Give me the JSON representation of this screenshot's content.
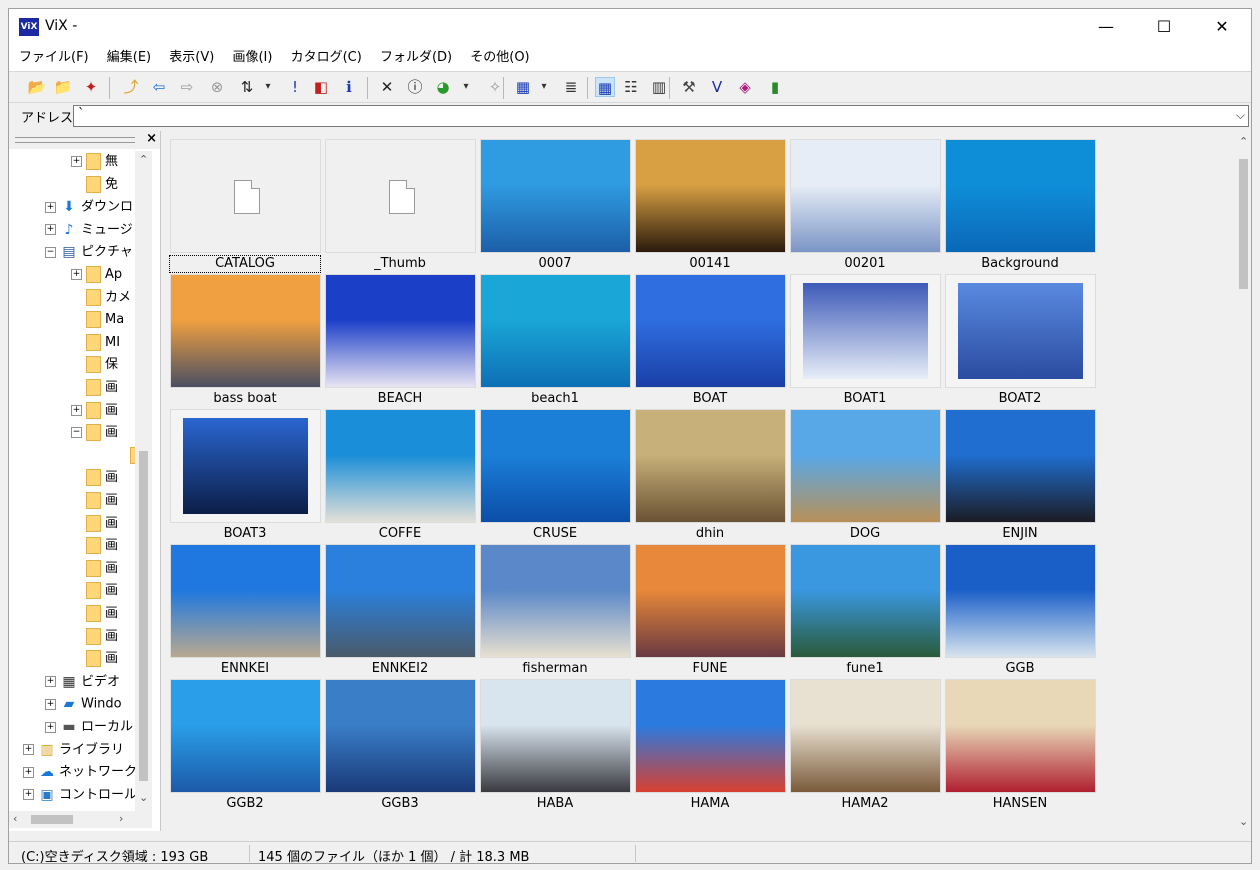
{
  "window": {
    "title": "ViX -",
    "app_icon": "ViX",
    "minimize": "—",
    "maximize": "☐",
    "close": "✕"
  },
  "menu": [
    "ファイル(F)",
    "編集(E)",
    "表示(V)",
    "画像(I)",
    "カタログ(C)",
    "フォルダ(D)",
    "その他(O)"
  ],
  "toolbar": {
    "icons": [
      "open-folder-icon",
      "new-folder-icon",
      "slideshow-icon",
      "up-folder-icon",
      "back-arrow-icon",
      "forward-arrow-icon",
      "stop-icon",
      "sort-icon",
      "sort-dropdown-icon",
      "exclamation-icon",
      "preview-icon",
      "info-icon",
      "delete-icon",
      "properties-icon",
      "color-icon",
      "color-dropdown-icon",
      "plugin-icon",
      "view-menu-icon",
      "view-dropdown-icon",
      "list-icon",
      "large-thumbnails-icon",
      "details-icon",
      "columns-icon",
      "tools-icon",
      "vix-icon",
      "book-icon",
      "exit-icon"
    ],
    "glyphs": [
      "📂",
      "📁",
      "✦",
      "⤴",
      "⇦",
      "⇨",
      "⊗",
      "⇅",
      "▾",
      "!",
      "◧",
      "ℹ",
      "✕",
      "ⓘ",
      "◕",
      "▾",
      "✧",
      "▦",
      "▾",
      "≣",
      "▦",
      "☷",
      "▥",
      "⚒",
      "V",
      "◈",
      "▮"
    ]
  },
  "address": {
    "label": "アドレス",
    "value": "`"
  },
  "tree": {
    "nodes": [
      {
        "label": "無",
        "level": 3,
        "type": "folder",
        "expander": "+"
      },
      {
        "label": "免",
        "level": 3,
        "type": "folder",
        "expander": ""
      },
      {
        "label": "ダウンロ",
        "level": 2,
        "type": "download",
        "expander": "+"
      },
      {
        "label": "ミュージ",
        "level": 2,
        "type": "music",
        "expander": "+"
      },
      {
        "label": "ピクチャ",
        "level": 2,
        "type": "pictures",
        "expander": "−"
      },
      {
        "label": "Ap",
        "level": 3,
        "type": "folder",
        "expander": "+"
      },
      {
        "label": "カメ",
        "level": 3,
        "type": "folder",
        "expander": ""
      },
      {
        "label": "Ma",
        "level": 3,
        "type": "folder",
        "expander": ""
      },
      {
        "label": "MI",
        "level": 3,
        "type": "folder",
        "expander": ""
      },
      {
        "label": "保",
        "level": 3,
        "type": "folder",
        "expander": ""
      },
      {
        "label": "画",
        "level": 3,
        "type": "folder",
        "expander": ""
      },
      {
        "label": "画",
        "level": 3,
        "type": "folder",
        "expander": "+"
      },
      {
        "label": "画",
        "level": 3,
        "type": "folder",
        "expander": "−"
      },
      {
        "label": "",
        "level": 4,
        "type": "folder",
        "expander": ""
      },
      {
        "label": "画",
        "level": 3,
        "type": "folder",
        "expander": ""
      },
      {
        "label": "画",
        "level": 3,
        "type": "folder",
        "expander": ""
      },
      {
        "label": "画",
        "level": 3,
        "type": "folder",
        "expander": ""
      },
      {
        "label": "画",
        "level": 3,
        "type": "folder",
        "expander": ""
      },
      {
        "label": "画",
        "level": 3,
        "type": "folder",
        "expander": ""
      },
      {
        "label": "画",
        "level": 3,
        "type": "folder",
        "expander": ""
      },
      {
        "label": "画",
        "level": 3,
        "type": "folder",
        "expander": ""
      },
      {
        "label": "画",
        "level": 3,
        "type": "folder",
        "expander": ""
      },
      {
        "label": "画",
        "level": 3,
        "type": "folder",
        "expander": ""
      },
      {
        "label": "ビデオ",
        "level": 2,
        "type": "video",
        "expander": "+"
      },
      {
        "label": "Windo",
        "level": 2,
        "type": "windows",
        "expander": "+"
      },
      {
        "label": "ローカル",
        "level": 2,
        "type": "drive",
        "expander": "+"
      },
      {
        "label": "ライブラリ",
        "level": 1,
        "type": "library",
        "expander": "+"
      },
      {
        "label": "ネットワーク",
        "level": 1,
        "type": "network",
        "expander": "+"
      },
      {
        "label": "コントロール",
        "level": 1,
        "type": "control",
        "expander": "+"
      }
    ]
  },
  "thumbnails": [
    {
      "name": "CATALOG",
      "kind": "folder",
      "c1": "#f0f0f0",
      "c2": "#f0f0f0"
    },
    {
      "name": "_Thumb",
      "kind": "folder",
      "c1": "#f0f0f0",
      "c2": "#f0f0f0"
    },
    {
      "name": "0007",
      "kind": "photo",
      "c1": "#2f9be0",
      "c2": "#1c5fa8"
    },
    {
      "name": "00141",
      "kind": "photo",
      "c1": "#d8a043",
      "c2": "#2a1a0c"
    },
    {
      "name": "00201",
      "kind": "photo",
      "c1": "#e6edf6",
      "c2": "#7b95c6"
    },
    {
      "name": "Background",
      "kind": "photo",
      "c1": "#0f8ed8",
      "c2": "#0a68b8"
    },
    {
      "name": "bass boat",
      "kind": "photo",
      "c1": "#f0a040",
      "c2": "#4a4f62"
    },
    {
      "name": "BEACH",
      "kind": "photo",
      "c1": "#1c3fc8",
      "c2": "#e8e4f2"
    },
    {
      "name": "beach1",
      "kind": "photo",
      "c1": "#1aa6d6",
      "c2": "#0d6fb5"
    },
    {
      "name": "BOAT",
      "kind": "photo",
      "c1": "#2e6ee0",
      "c2": "#1a3fa6"
    },
    {
      "name": "BOAT1",
      "kind": "framed",
      "c1": "#3d5ab8",
      "c2": "#e8eef8"
    },
    {
      "name": "BOAT2",
      "kind": "framed",
      "c1": "#5a8ae0",
      "c2": "#2a4ca0"
    },
    {
      "name": "BOAT3",
      "kind": "framed",
      "c1": "#2a66d0",
      "c2": "#0c1e48"
    },
    {
      "name": "COFFE",
      "kind": "photo",
      "c1": "#1a8ed8",
      "c2": "#e4e0d8"
    },
    {
      "name": "CRUSE",
      "kind": "photo",
      "c1": "#1b7fd8",
      "c2": "#0b4ea8"
    },
    {
      "name": "dhin",
      "kind": "photo",
      "c1": "#c8b07a",
      "c2": "#6a5234"
    },
    {
      "name": "DOG",
      "kind": "photo",
      "c1": "#58a8e8",
      "c2": "#b89058"
    },
    {
      "name": "ENJIN",
      "kind": "photo",
      "c1": "#1f6ed0",
      "c2": "#1c1c24"
    },
    {
      "name": "ENNKEI",
      "kind": "photo",
      "c1": "#1e78e0",
      "c2": "#b8a890"
    },
    {
      "name": "ENNKEI2",
      "kind": "photo",
      "c1": "#2a80dc",
      "c2": "#4a5a6a"
    },
    {
      "name": "fisherman",
      "kind": "photo",
      "c1": "#5a88c8",
      "c2": "#e8e0d0"
    },
    {
      "name": "FUNE",
      "kind": "photo",
      "c1": "#e8883a",
      "c2": "#6a3a42"
    },
    {
      "name": "fune1",
      "kind": "photo",
      "c1": "#3a98e0",
      "c2": "#2a5a3a"
    },
    {
      "name": "GGB",
      "kind": "photo",
      "c1": "#1a5fc8",
      "c2": "#d8e4ee"
    },
    {
      "name": "GGB2",
      "kind": "photo",
      "c1": "#2a9ee8",
      "c2": "#1c5aa8"
    },
    {
      "name": "GGB3",
      "kind": "photo",
      "c1": "#3a7ec8",
      "c2": "#1a3a78"
    },
    {
      "name": "HABA",
      "kind": "photo",
      "c1": "#d8e4ee",
      "c2": "#3a3a40"
    },
    {
      "name": "HAMA",
      "kind": "photo",
      "c1": "#2a7ae0",
      "c2": "#d84030"
    },
    {
      "name": "HAMA2",
      "kind": "photo",
      "c1": "#e8e0d0",
      "c2": "#7a5a3a"
    },
    {
      "name": "HANSEN",
      "kind": "photo",
      "c1": "#e8d8b8",
      "c2": "#b02030"
    }
  ],
  "status": {
    "disk": "(C:)空きディスク領域 : 193 GB",
    "files": "145 個のファイル（ほか 1 個） / 計 18.3 MB"
  }
}
